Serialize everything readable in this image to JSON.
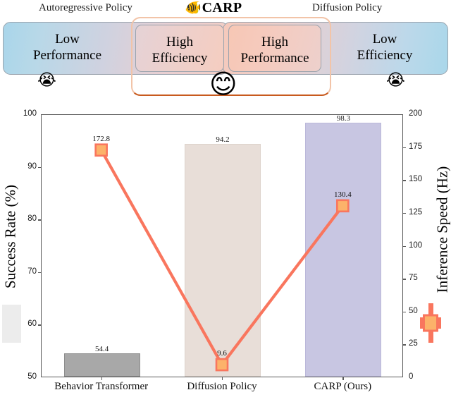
{
  "banner": {
    "left_caption": "Autoregressive Policy",
    "right_caption": "Diffusion Policy",
    "logo_icon": "tropical-fish-icon",
    "logo_glyph": "🐠",
    "logo_text": "CARP",
    "left_pill_text": "Low\nPerformance",
    "left_pill_line1": "Low",
    "left_pill_line2": "Performance",
    "mid_left_line1": "High",
    "mid_left_line2": "Efficiency",
    "mid_right_line1": "High",
    "mid_right_line2": "Performance",
    "right_pill_line1": "Low",
    "right_pill_line2": "Efficiency",
    "emoji_left": "😭",
    "emoji_right": "😭",
    "emoji_center": "😊",
    "bracket_color": "#c85a1e"
  },
  "chart_data": {
    "type": "bar",
    "title": "",
    "xlabel": "",
    "ylabel": "Success Rate (%)",
    "y2label": "Inference Speed (Hz)",
    "categories": [
      "Behavior Transformer",
      "Diffusion Policy",
      "CARP (Ours)"
    ],
    "ylim": [
      50,
      100
    ],
    "yticks": [
      100,
      90,
      80,
      70,
      60,
      50
    ],
    "y2lim": [
      0,
      200
    ],
    "y2ticks": [
      200,
      175,
      150,
      125,
      100,
      75,
      50,
      25,
      0
    ],
    "grid": false,
    "legend_position": "none",
    "series": [
      {
        "name": "Success Rate (%)",
        "type": "bar",
        "axis": "left",
        "values": [
          54.4,
          94.2,
          98.3
        ],
        "labels": [
          "54.4",
          "94.2",
          "98.3"
        ],
        "colors": [
          "#a8a8a8",
          "#e8ded8",
          "#c8c6e2"
        ],
        "edgecolors": [
          "#8c8c8c",
          "#ddd2cb",
          "#bbb8da"
        ]
      },
      {
        "name": "Inference Speed (Hz)",
        "type": "line",
        "axis": "right",
        "values": [
          172.8,
          9.6,
          130.4
        ],
        "labels": [
          "172.8",
          "9.6",
          "130.4"
        ],
        "line_color": "#f9765e",
        "marker_color": "#fcb26a",
        "marker": "square"
      }
    ]
  }
}
